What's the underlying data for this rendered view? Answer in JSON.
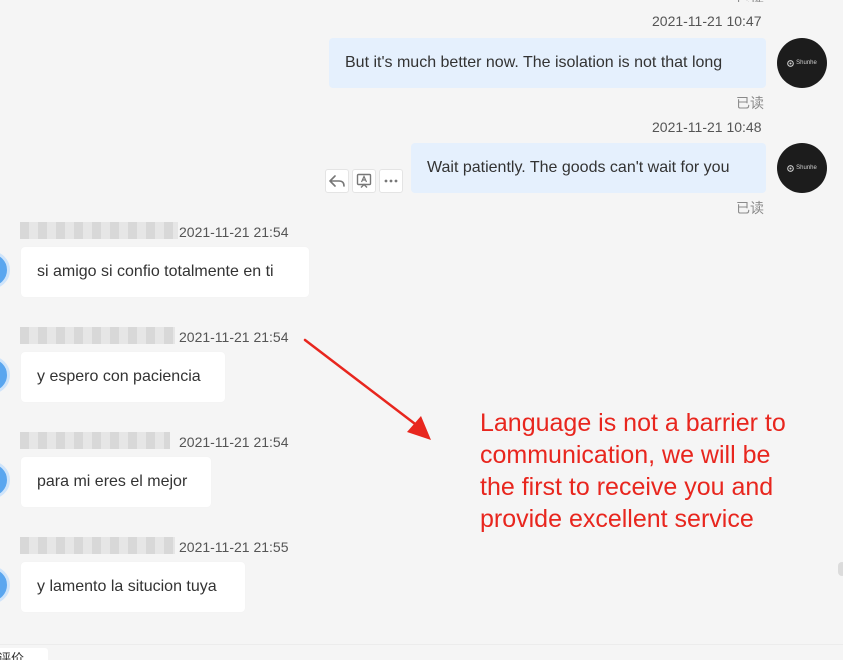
{
  "outgoing": [
    {
      "time": "2021-11-21 10:47",
      "text": "But it's much better now. The isolation is not that long",
      "status": "已读",
      "avatar_brand": "Shunhe"
    },
    {
      "time": "2021-11-21 10:48",
      "text": "Wait patiently. The goods can't wait for you",
      "status": "已读",
      "avatar_brand": "Shunhe"
    }
  ],
  "message_actions": [
    "reply-icon",
    "translate-icon",
    "more-icon"
  ],
  "incoming": [
    {
      "time": "2021-11-21 21:54",
      "text": "si amigo si confio totalmente en ti"
    },
    {
      "time": "2021-11-21 21:54",
      "text": "y espero con paciencia"
    },
    {
      "time": "2021-11-21 21:54",
      "text": "para mi eres el mejor"
    },
    {
      "time": "2021-11-21 21:55",
      "text": "y lamento la situcion tuya"
    }
  ],
  "annotation": {
    "lines": [
      "Language is not a barrier to",
      "communication, we will be",
      "the first to receive you and",
      "provide excellent service"
    ],
    "color": "#e8261e"
  },
  "bottom_tab_label": "评价",
  "colors": {
    "outgoing_bubble": "#e5f0fd",
    "incoming_bubble": "#ffffff",
    "background": "#f5f5f5",
    "incoming_avatar": "#5aa6ef"
  }
}
